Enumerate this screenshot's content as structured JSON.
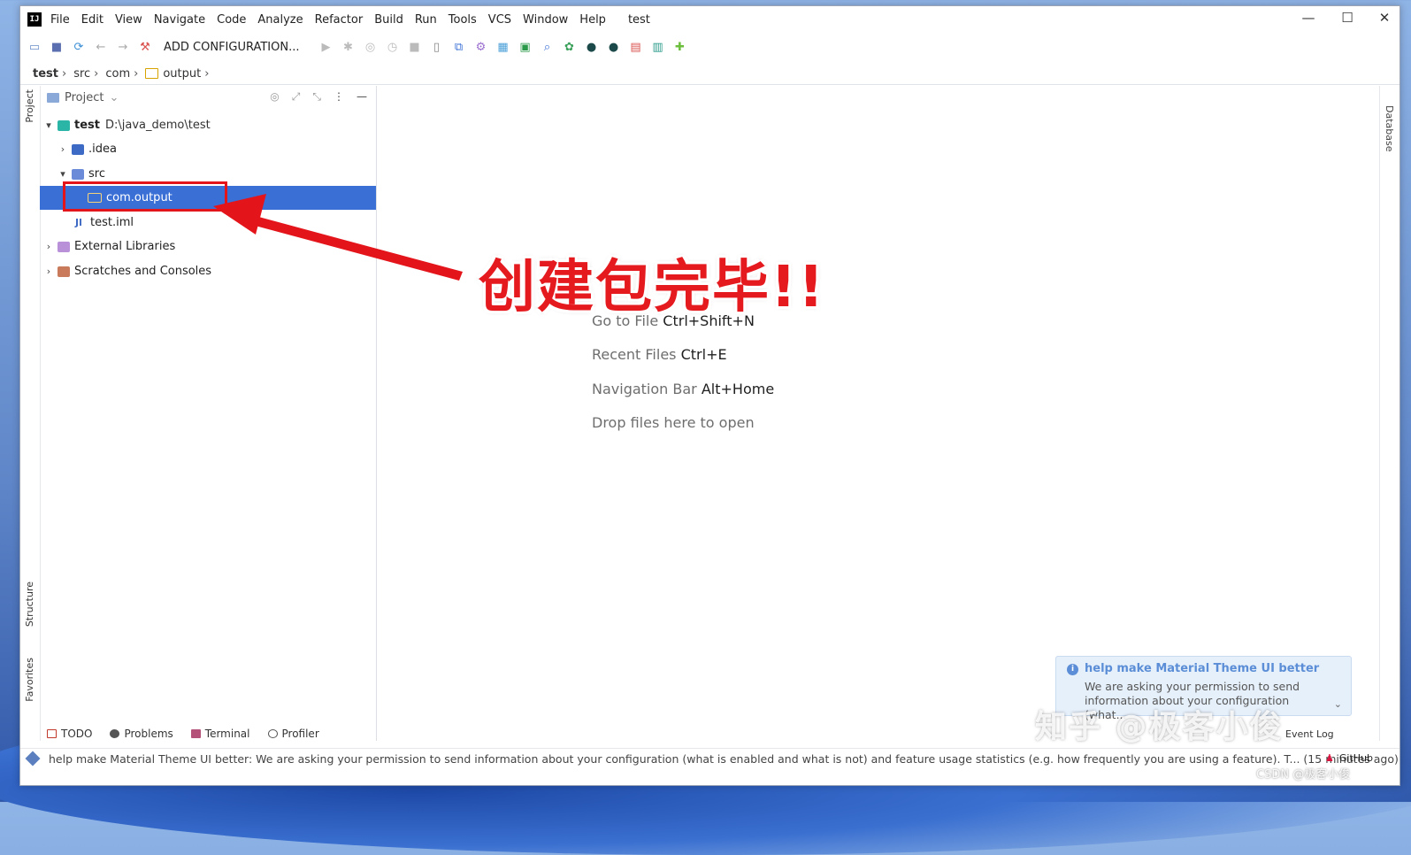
{
  "menubar": {
    "items": [
      "File",
      "Edit",
      "View",
      "Navigate",
      "Code",
      "Analyze",
      "Refactor",
      "Build",
      "Run",
      "Tools",
      "VCS",
      "Window",
      "Help"
    ],
    "window_title": "test"
  },
  "window_controls": {
    "minimize": "—",
    "maximize": "☐",
    "close": "✕"
  },
  "toolbar": {
    "config_label": "ADD CONFIGURATION..."
  },
  "breadcrumb": {
    "items": [
      "test",
      "src",
      "com",
      "output"
    ]
  },
  "left_stripe": {
    "project": "Project",
    "structure": "Structure",
    "favorites": "Favorites"
  },
  "right_stripe": {
    "database": "Database"
  },
  "project_panel": {
    "header": "Project",
    "tree": [
      {
        "label": "test",
        "path": "D:\\java_demo\\test",
        "arrow": "▾",
        "icon": "project-folder-icon"
      },
      {
        "label": ".idea",
        "arrow": "›",
        "icon": "idea-folder-icon"
      },
      {
        "label": "src",
        "arrow": "▾",
        "icon": "source-folder-icon"
      },
      {
        "label": "com.output",
        "arrow": "",
        "icon": "package-icon",
        "selected": true
      },
      {
        "label": "test.iml",
        "arrow": "",
        "icon": "iml-file-icon"
      },
      {
        "label": "External Libraries",
        "arrow": "›",
        "icon": "library-icon"
      },
      {
        "label": "Scratches and Consoles",
        "arrow": "›",
        "icon": "scratches-icon"
      }
    ]
  },
  "annotation": {
    "text": "创建包完毕!!",
    "color": "#e51a1f"
  },
  "editor_hints": [
    {
      "label": "Go to File",
      "shortcut": "Ctrl+Shift+N"
    },
    {
      "label": "Recent Files",
      "shortcut": "Ctrl+E"
    },
    {
      "label": "Navigation Bar",
      "shortcut": "Alt+Home"
    },
    {
      "label": "Drop files here to open",
      "shortcut": ""
    }
  ],
  "notification": {
    "title": "help make Material Theme UI better",
    "body": "We are asking your permission to send information about your configuration (what..."
  },
  "bottom_tabs": [
    "TODO",
    "Problems",
    "Terminal",
    "Profiler"
  ],
  "statusbar": {
    "message": "help make Material Theme UI better: We are asking your permission to send information about your configuration (what is enabled and what is not) and feature usage statistics (e.g. how frequently you are using a feature). T... (15 minutes ago)",
    "github": "GitHub",
    "event_log": "Event Log"
  },
  "watermark": {
    "main": "知乎 @极客小俊",
    "csdn": "CSDN @极客小俊"
  },
  "colors": {
    "selection": "#3a6fd6",
    "accent": "#5b8ed6"
  }
}
